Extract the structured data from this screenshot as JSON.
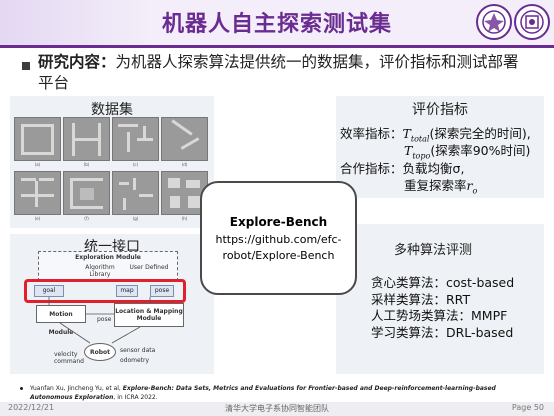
{
  "header": {
    "title": "机器人自主探索测试集"
  },
  "bullet": {
    "label": "研究内容：",
    "text": "为机器人探索算法提供统一的数据集，评价指标和测试部署平台"
  },
  "dataset": {
    "title": "数据集",
    "captions": [
      "(a)",
      "(b)",
      "(c)",
      "(d)",
      "(e)",
      "(f)",
      "(g)",
      "(h)"
    ]
  },
  "metrics": {
    "title": "评价指标",
    "eff_label": "效率指标：",
    "t_total_sym": "T",
    "t_total_sub": "total",
    "t_total_desc": "(探索完全的时间),",
    "t_topo_sym": "T",
    "t_topo_sub": "topo",
    "t_topo_desc": "(探索率90%时间)",
    "coop_label": "合作指标：",
    "coop_line1": "负载均衡σ,",
    "coop_line2_prefix": "重复探索率",
    "coop_line2_sym": "r",
    "coop_line2_sub": "o"
  },
  "interface": {
    "title": "统一接口",
    "exploration_module": "Exploration Module",
    "algorithm_library": "Algorithm Library",
    "user_defined": "User Defined",
    "goal": "goal",
    "map": "map",
    "pose1": "pose",
    "pose2": "pose",
    "motion_module": "Motion Module",
    "loc_mapping": "Location & Mapping Module",
    "robot": "Robot",
    "velocity_command": "velocity command",
    "sensor_data": "sensor data",
    "odometry": "odometry"
  },
  "callout": {
    "title": "Explore-Bench",
    "url_line1": "https://github.com/efc-",
    "url_line2": "robot/Explore-Bench"
  },
  "algorithms": {
    "title": "多种算法评测",
    "items": [
      "贪心类算法：cost-based",
      "采样类算法：RRT",
      "人工势场类算法：MMPF",
      "学习类算法：DRL-based"
    ]
  },
  "reference": {
    "authors": "Yuanfan Xu, Jincheng Yu, et al, ",
    "title": "Explore-Bench: Data Sets, Metrics and Evaluations for Frontier-based and Deep-reinforcement-learning-based Autonomous Exploration",
    "venue": ", in ICRA 2022."
  },
  "footer": {
    "date": "2022/12/21",
    "team": "清华大学电子系协同智能团队",
    "page": "Page 50"
  },
  "colors": {
    "accent": "#6a2c91",
    "highlight": "#e0202a",
    "panel": "#eef1f5"
  }
}
